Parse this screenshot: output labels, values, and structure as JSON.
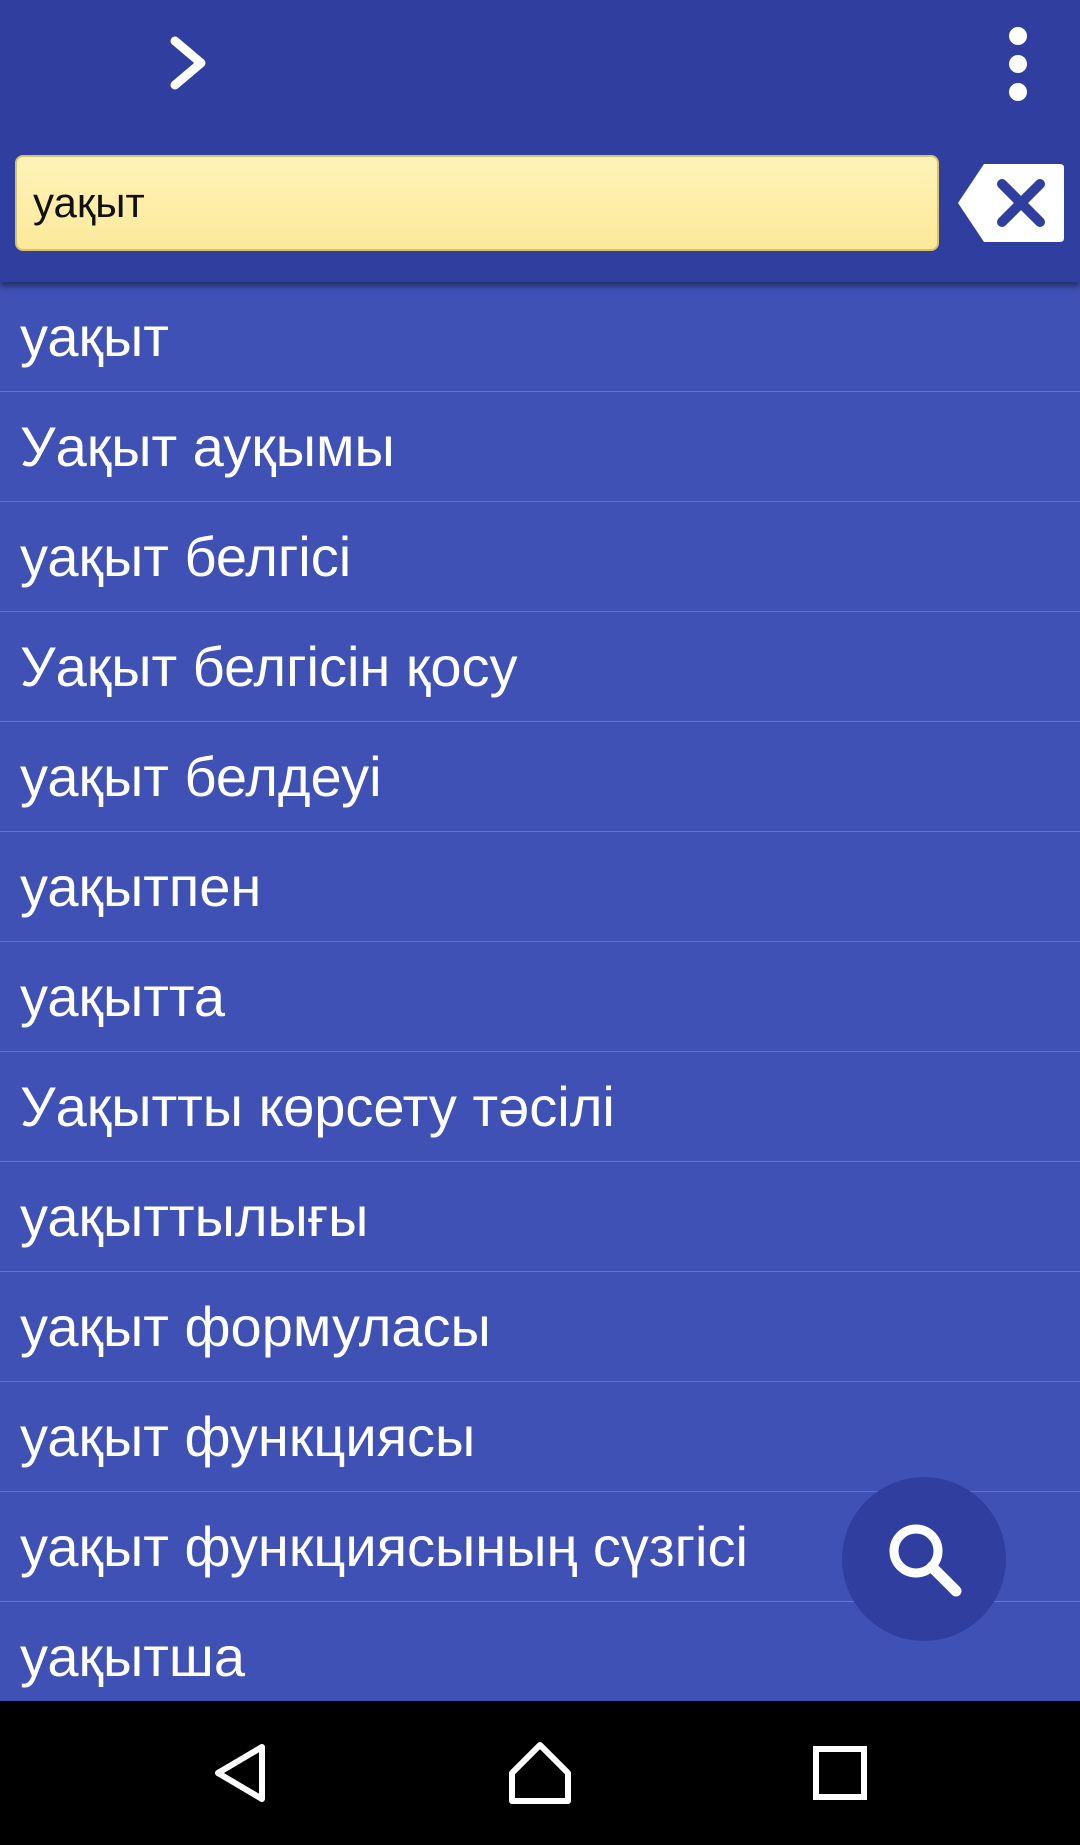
{
  "toolbar": {
    "forward_icon": "chevron-right-icon",
    "menu_icon": "more-vertical-icon",
    "clear_icon": "backspace-clear-icon"
  },
  "search": {
    "value": "уақыт"
  },
  "results": [
    "уақыт",
    "Уақыт ауқымы",
    "уақыт белгісі",
    "Уақыт белгісін қосу",
    "уақыт белдеуі",
    "уақытпен",
    "уақытта",
    "Уақытты көрсету тәсілі",
    "уақыттылығы",
    "уақыт формуласы",
    "уақыт функциясы",
    "уақыт функциясының сүзгісі",
    "уақытша"
  ],
  "fab": {
    "icon": "search-icon"
  },
  "navbar": {
    "icons": [
      "back-icon",
      "home-icon",
      "recents-icon"
    ]
  },
  "colors": {
    "appbar": "#303f9f",
    "list_background": "#3f51b5",
    "search_field": "#fff3b8",
    "divider": "#6474c7",
    "text": "#ffffff",
    "navbar": "#000000"
  }
}
